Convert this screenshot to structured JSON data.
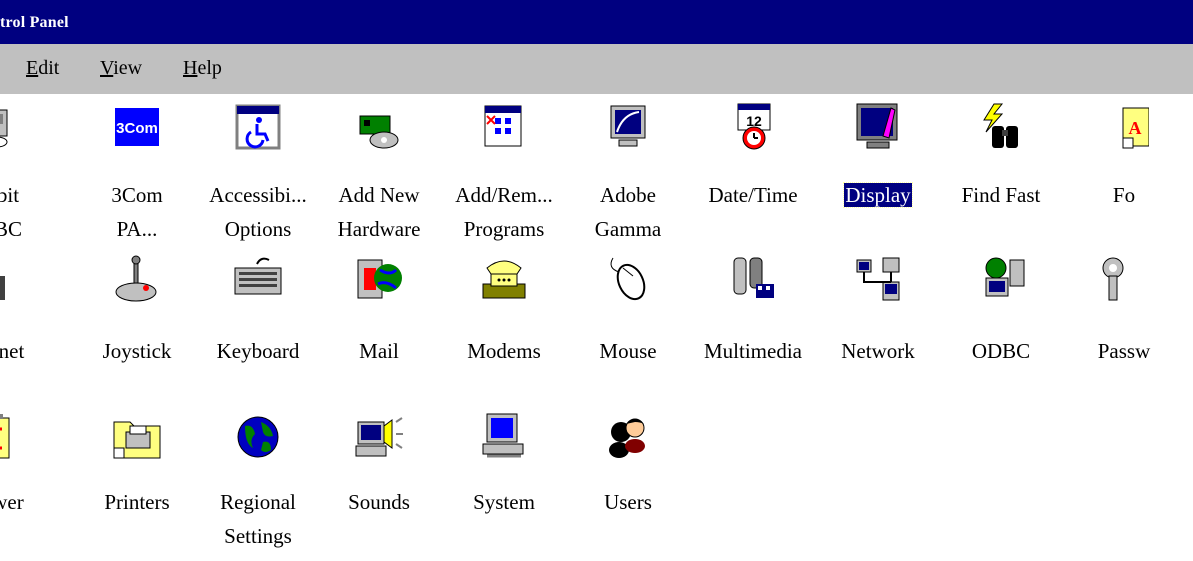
{
  "window": {
    "title": "trol Panel"
  },
  "menu": [
    {
      "label": "Edit",
      "accel": "E",
      "rest": "dit"
    },
    {
      "label": "View",
      "accel": "V",
      "rest": "iew"
    },
    {
      "label": "Help",
      "accel": "H",
      "rest": "elp"
    }
  ],
  "items": [
    {
      "id": "32bit-odbc",
      "lines": [
        "bit",
        "BC"
      ],
      "icon": "odbc-32bit-icon"
    },
    {
      "id": "3com-pa",
      "lines": [
        "3Com",
        "PA..."
      ],
      "icon": "3com-icon",
      "icon_text": "3Com"
    },
    {
      "id": "accessibility",
      "lines": [
        "Accessibi...",
        "Options"
      ],
      "icon": "accessibility-icon"
    },
    {
      "id": "add-hardware",
      "lines": [
        "Add New",
        "Hardware"
      ],
      "icon": "add-hardware-icon"
    },
    {
      "id": "add-remove",
      "lines": [
        "Add/Rem...",
        "Programs"
      ],
      "icon": "add-remove-programs-icon"
    },
    {
      "id": "adobe-gamma",
      "lines": [
        "Adobe",
        "Gamma"
      ],
      "icon": "monitor-gamma-icon"
    },
    {
      "id": "date-time",
      "lines": [
        "Date/Time"
      ],
      "icon": "calendar-clock-icon",
      "icon_text": "12"
    },
    {
      "id": "display",
      "lines": [
        "Display"
      ],
      "icon": "display-monitor-icon",
      "selected": true
    },
    {
      "id": "find-fast",
      "lines": [
        "Find Fast"
      ],
      "icon": "binoculars-lightning-icon"
    },
    {
      "id": "fonts",
      "lines": [
        "Fo"
      ],
      "icon": "fonts-folder-icon"
    },
    {
      "id": "internet",
      "lines": [
        "rnet"
      ],
      "icon": "internet-icon"
    },
    {
      "id": "joystick",
      "lines": [
        "Joystick"
      ],
      "icon": "joystick-icon"
    },
    {
      "id": "keyboard",
      "lines": [
        "Keyboard"
      ],
      "icon": "keyboard-icon"
    },
    {
      "id": "mail",
      "lines": [
        "Mail"
      ],
      "icon": "mail-icon"
    },
    {
      "id": "modems",
      "lines": [
        "Modems"
      ],
      "icon": "telephone-modem-icon"
    },
    {
      "id": "mouse",
      "lines": [
        "Mouse"
      ],
      "icon": "mouse-icon"
    },
    {
      "id": "multimedia",
      "lines": [
        "Multimedia"
      ],
      "icon": "multimedia-icon"
    },
    {
      "id": "network",
      "lines": [
        "Network"
      ],
      "icon": "network-icon"
    },
    {
      "id": "odbc",
      "lines": [
        "ODBC"
      ],
      "icon": "odbc-icon"
    },
    {
      "id": "passwords",
      "lines": [
        "Passw"
      ],
      "icon": "keys-icon"
    },
    {
      "id": "power",
      "lines": [
        "wer"
      ],
      "icon": "battery-icon"
    },
    {
      "id": "printers",
      "lines": [
        "Printers"
      ],
      "icon": "printers-folder-icon"
    },
    {
      "id": "regional",
      "lines": [
        "Regional",
        "Settings"
      ],
      "icon": "globe-icon"
    },
    {
      "id": "sounds",
      "lines": [
        "Sounds"
      ],
      "icon": "speaker-computer-icon"
    },
    {
      "id": "system",
      "lines": [
        "System"
      ],
      "icon": "computer-icon"
    },
    {
      "id": "users",
      "lines": [
        "Users"
      ],
      "icon": "users-icon"
    }
  ],
  "colors": {
    "titlebar": "#000080",
    "menubar": "#c0c0c0",
    "selection": "#000080"
  }
}
